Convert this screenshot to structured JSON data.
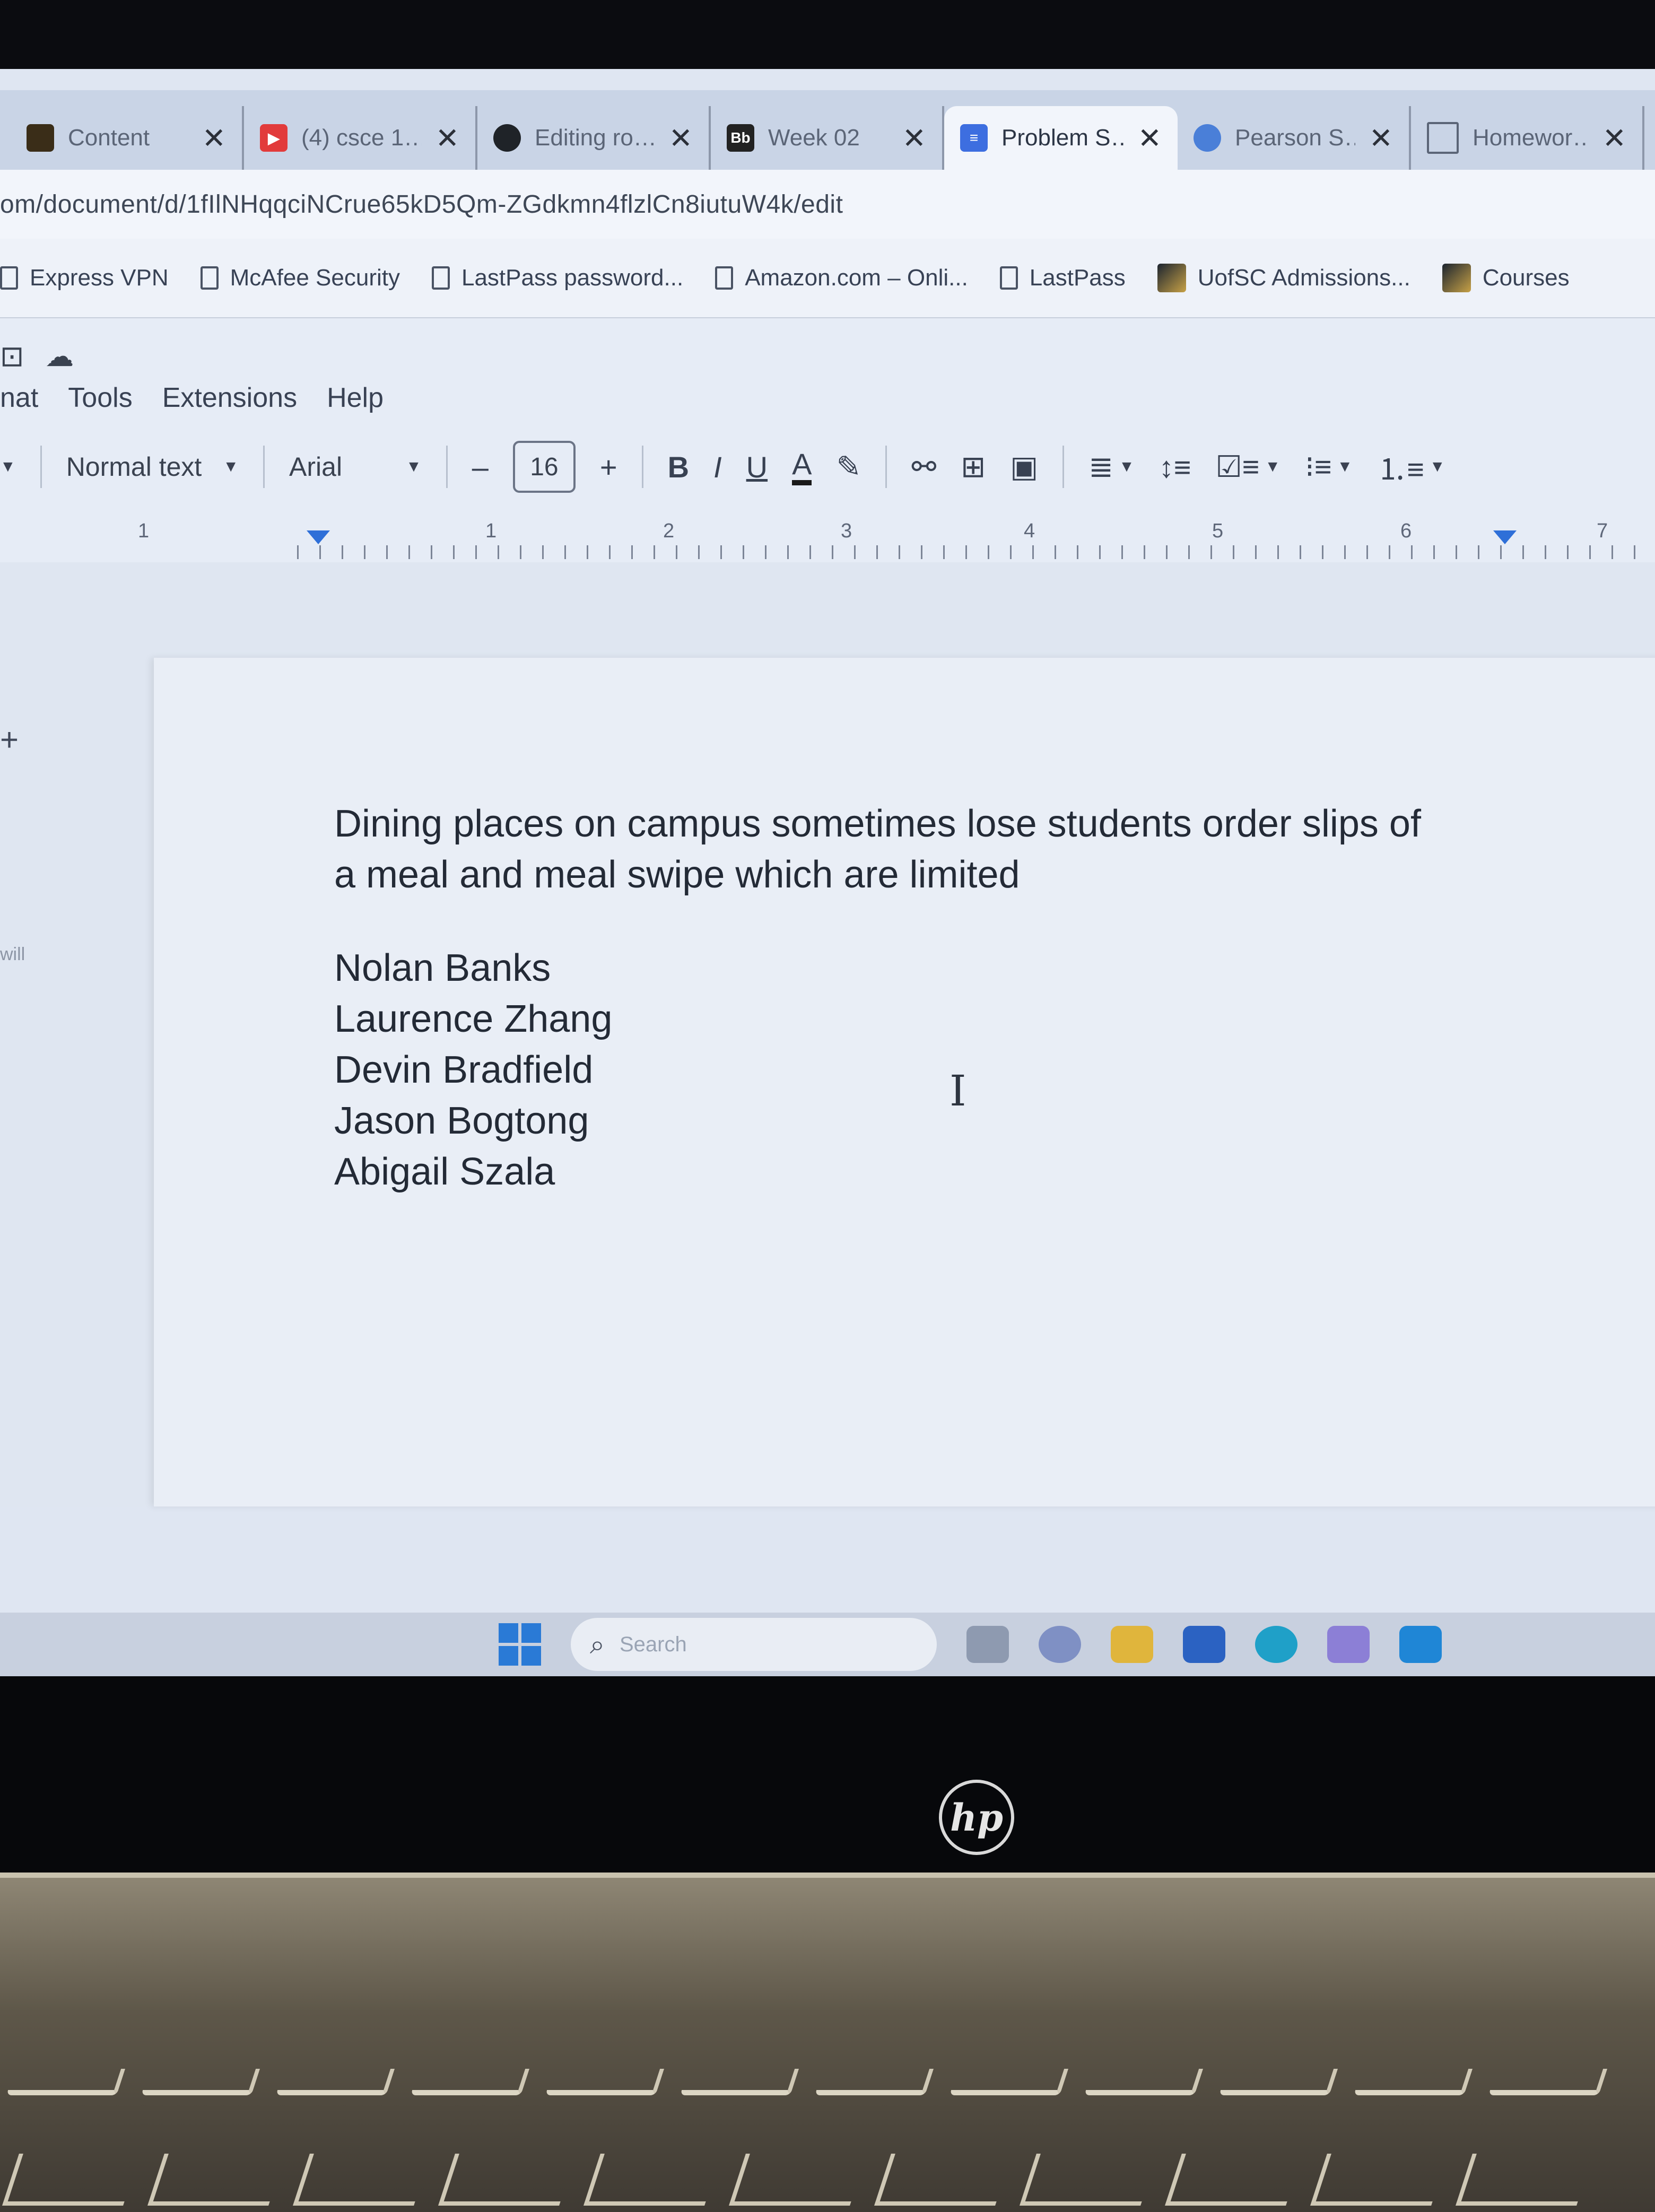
{
  "tabs": [
    {
      "title": "Content",
      "fav_color": "#3a2d18",
      "active": false
    },
    {
      "title": "(4) csce 1…",
      "fav_color": "#e23b3b",
      "active": false
    },
    {
      "title": "Editing ro…",
      "fav_color": "#1f2328",
      "active": false
    },
    {
      "title": "Week 02",
      "fav_color": "#222222",
      "fav_text": "Bb",
      "active": false
    },
    {
      "title": "Problem S…",
      "fav_color": "#3d6ee0",
      "active": true
    },
    {
      "title": "Pearson S…",
      "fav_color": "#4a7fd8",
      "active": false
    },
    {
      "title": "Homewor…",
      "fav_color": "#ffffff",
      "active": false
    }
  ],
  "address": {
    "url": "om/document/d/1fIlNHqqciNCrue65kD5Qm-ZGdkmn4flzlCn8iutuW4k/edit"
  },
  "bookmarks": [
    {
      "label": "Express VPN",
      "icon": "doc"
    },
    {
      "label": "McAfee Security",
      "icon": "doc"
    },
    {
      "label": "LastPass password...",
      "icon": "doc"
    },
    {
      "label": "Amazon.com – Onli...",
      "icon": "doc"
    },
    {
      "label": "LastPass",
      "icon": "doc"
    },
    {
      "label": "UofSC Admissions...",
      "icon": "pic"
    },
    {
      "label": "Courses",
      "icon": "pic"
    }
  ],
  "menu": {
    "format": "nat",
    "tools": "Tools",
    "extensions": "Extensions",
    "help": "Help"
  },
  "toolbar": {
    "style_value": "Normal text",
    "font_value": "Arial",
    "font_size": "16",
    "minus": "–",
    "plus": "+",
    "bold": "B",
    "italic": "I",
    "underline": "U",
    "text_color": "A"
  },
  "ruler": {
    "labels": [
      "1",
      "1",
      "2",
      "3",
      "4",
      "5",
      "6",
      "7"
    ]
  },
  "document": {
    "paragraph_line1": "Dining places on campus sometimes lose students order slips of",
    "paragraph_line2": "a meal and meal swipe which are limited",
    "names": [
      "Nolan Banks",
      "Laurence Zhang",
      "Devin Bradfield",
      "Jason Bogtong",
      "Abigail Szala"
    ],
    "left_margin_text": "will",
    "left_plus": "+"
  },
  "taskbar": {
    "search_placeholder": "Search"
  },
  "laptop": {
    "logo": "hp"
  }
}
